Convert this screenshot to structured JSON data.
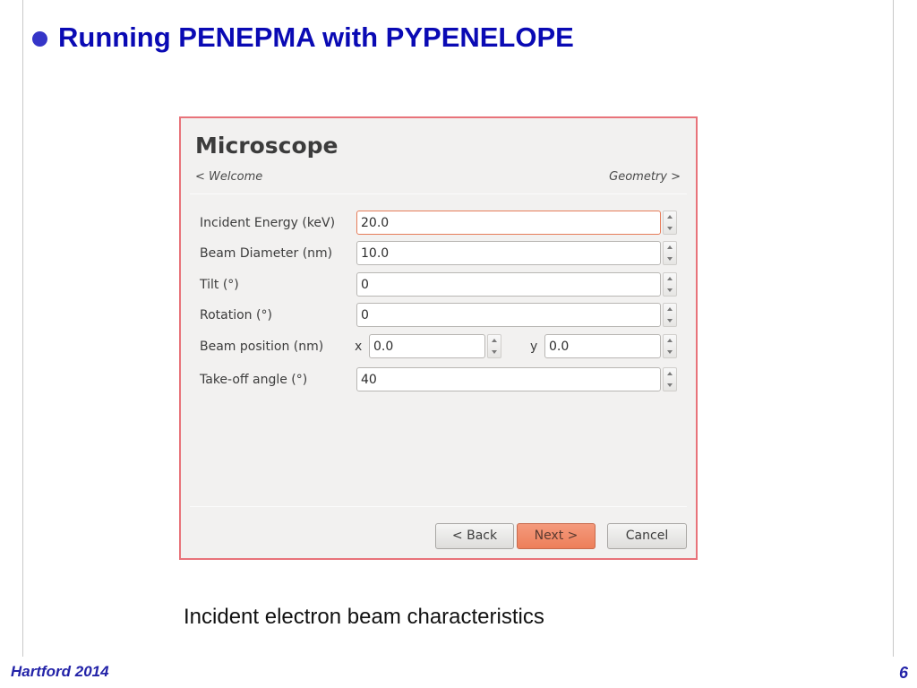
{
  "slide": {
    "title": "Running PENEPMA with PYPENELOPE",
    "caption": "Incident electron beam characteristics",
    "footer_left": "Hartford 2014",
    "page_number": "6",
    "title_color": "#0a0ab4",
    "border_color": "#e8737a"
  },
  "dialog": {
    "title": "Microscope",
    "nav_prev": "< Welcome",
    "nav_next": "Geometry >",
    "fields": [
      {
        "label": "Incident Energy (keV)",
        "value": "20.0",
        "focused": true
      },
      {
        "label": "Beam Diameter (nm)",
        "value": "10.0"
      },
      {
        "label": "Tilt (°)",
        "value": "0"
      },
      {
        "label": "Rotation (°)",
        "value": "0"
      },
      {
        "label": "Beam position (nm)",
        "x_label": "x",
        "x_value": "0.0",
        "y_label": "y",
        "y_value": "0.0"
      },
      {
        "label": "Take-off angle (°)",
        "value": "40"
      }
    ],
    "buttons": {
      "back": "< Back",
      "next": "Next >",
      "cancel": "Cancel"
    },
    "accent_color": "#ed7f5a"
  }
}
